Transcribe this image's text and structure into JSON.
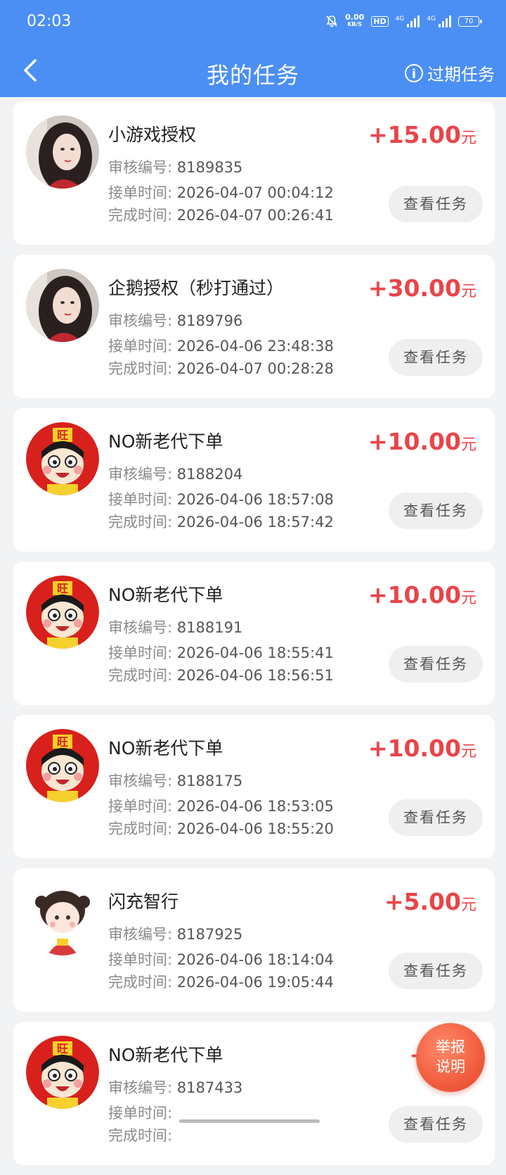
{
  "status_bar": {
    "time": "02:03",
    "net_speed": "0.00",
    "net_unit": "KB/S",
    "hd": "HD",
    "sig1": "4G",
    "sig2": "4G",
    "battery": "70"
  },
  "header": {
    "title": "我的任务",
    "expired_label": "过期任务",
    "back_icon": "chevron-left-icon",
    "info_icon": "info-circle-icon"
  },
  "labels": {
    "review_no": "审核编号:",
    "accept_time": "接单时间:",
    "finish_time": "完成时间:",
    "view_task": "查看任务",
    "unit": "元"
  },
  "tasks": [
    {
      "title": "小游戏授权",
      "reward": "+15.00",
      "review_no": "8189835",
      "accept_time": "2026-04-07 00:04:12",
      "finish_time": "2026-04-07 00:26:41",
      "avatar": "girl-photo"
    },
    {
      "title": "企鹅授权（秒打通过）",
      "reward": "+30.00",
      "review_no": "8189796",
      "accept_time": "2026-04-06 23:48:38",
      "finish_time": "2026-04-07 00:28:28",
      "avatar": "girl-photo"
    },
    {
      "title": "NO新老代下单",
      "reward": "+10.00",
      "review_no": "8188204",
      "accept_time": "2026-04-06 18:57:08",
      "finish_time": "2026-04-06 18:57:42",
      "avatar": "wangzai-logo"
    },
    {
      "title": "NO新老代下单",
      "reward": "+10.00",
      "review_no": "8188191",
      "accept_time": "2026-04-06 18:55:41",
      "finish_time": "2026-04-06 18:56:51",
      "avatar": "wangzai-logo"
    },
    {
      "title": "NO新老代下单",
      "reward": "+10.00",
      "review_no": "8188175",
      "accept_time": "2026-04-06 18:53:05",
      "finish_time": "2026-04-06 18:55:20",
      "avatar": "wangzai-logo"
    },
    {
      "title": "闪充智行",
      "reward": "+5.00",
      "review_no": "8187925",
      "accept_time": "2026-04-06 18:14:04",
      "finish_time": "2026-04-06 19:05:44",
      "avatar": "cartoon-girl"
    },
    {
      "title": "NO新老代下单",
      "reward": "+10",
      "review_no": "8187433",
      "accept_time": "",
      "finish_time": "",
      "avatar": "wangzai-logo"
    }
  ],
  "fab": {
    "line1": "举报",
    "line2": "说明"
  },
  "colors": {
    "header": "#4b8ff5",
    "reward": "#e8454a",
    "fab": "#f05a3c"
  }
}
